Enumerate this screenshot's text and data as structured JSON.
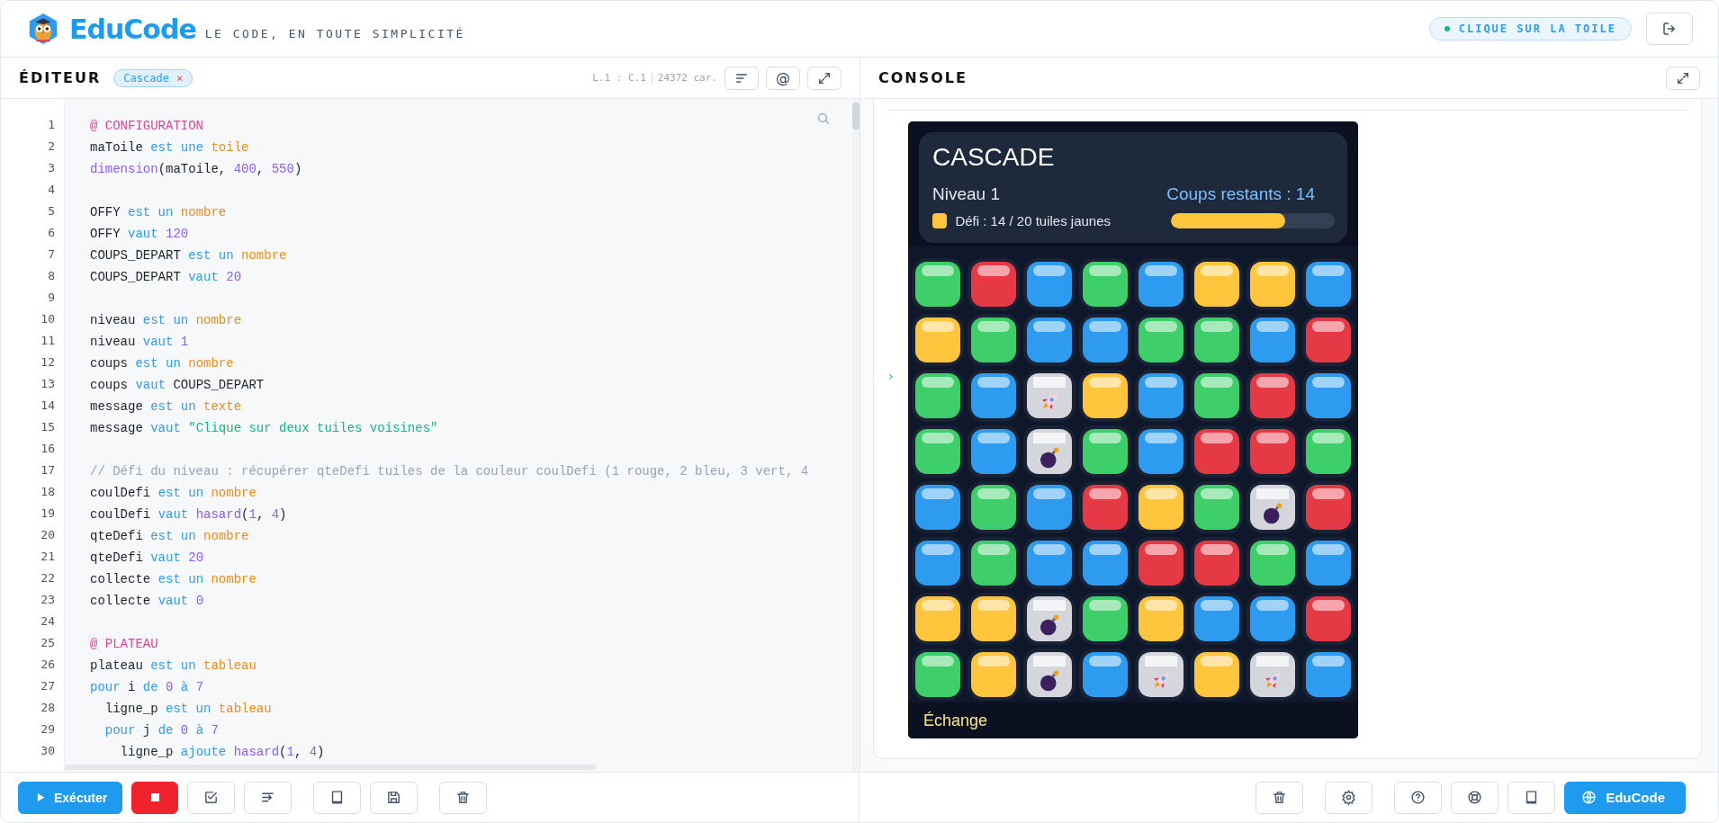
{
  "header": {
    "brand": "EduCode",
    "tagline": "LE CODE, EN TOUTE SIMPLICITÉ",
    "status": "CLIQUE SUR LA TOILE"
  },
  "editor": {
    "title": "ÉDITEUR",
    "tabs": [
      {
        "label": "Cascade",
        "close": "×",
        "selected": true
      }
    ],
    "cursor": "L.1 : C.1",
    "chars": "24372 car.",
    "at_button": "@",
    "lines": [
      {
        "number": "1",
        "tokens": [
          {
            "kind": "section",
            "text": "@ CONFIGURATION"
          }
        ]
      },
      {
        "number": "2",
        "tokens": [
          {
            "kind": "plain",
            "text": "maToile "
          },
          {
            "kind": "keyword",
            "text": "est une "
          },
          {
            "kind": "type",
            "text": "toile"
          }
        ]
      },
      {
        "number": "3",
        "tokens": [
          {
            "kind": "function",
            "text": "dimension"
          },
          {
            "kind": "plain",
            "text": "(maToile, "
          },
          {
            "kind": "number",
            "text": "400"
          },
          {
            "kind": "plain",
            "text": ", "
          },
          {
            "kind": "number",
            "text": "550"
          },
          {
            "kind": "plain",
            "text": ")"
          }
        ]
      },
      {
        "number": "4"
      },
      {
        "number": "5",
        "tokens": [
          {
            "kind": "plain",
            "text": "OFFY "
          },
          {
            "kind": "keyword",
            "text": "est un "
          },
          {
            "kind": "type",
            "text": "nombre"
          }
        ]
      },
      {
        "number": "6",
        "tokens": [
          {
            "kind": "plain",
            "text": "OFFY "
          },
          {
            "kind": "keyword",
            "text": "vaut "
          },
          {
            "kind": "number",
            "text": "120"
          }
        ]
      },
      {
        "number": "7",
        "tokens": [
          {
            "kind": "plain",
            "text": "COUPS_DEPART "
          },
          {
            "kind": "keyword",
            "text": "est un "
          },
          {
            "kind": "type",
            "text": "nombre"
          }
        ]
      },
      {
        "number": "8",
        "tokens": [
          {
            "kind": "plain",
            "text": "COUPS_DEPART "
          },
          {
            "kind": "keyword",
            "text": "vaut "
          },
          {
            "kind": "number",
            "text": "20"
          }
        ]
      },
      {
        "number": "9"
      },
      {
        "number": "10",
        "tokens": [
          {
            "kind": "plain",
            "text": "niveau "
          },
          {
            "kind": "keyword",
            "text": "est un "
          },
          {
            "kind": "type",
            "text": "nombre"
          }
        ]
      },
      {
        "number": "11",
        "tokens": [
          {
            "kind": "plain",
            "text": "niveau "
          },
          {
            "kind": "keyword",
            "text": "vaut "
          },
          {
            "kind": "number",
            "text": "1"
          }
        ]
      },
      {
        "number": "12",
        "tokens": [
          {
            "kind": "plain",
            "text": "coups "
          },
          {
            "kind": "keyword",
            "text": "est un "
          },
          {
            "kind": "type",
            "text": "nombre"
          }
        ]
      },
      {
        "number": "13",
        "tokens": [
          {
            "kind": "plain",
            "text": "coups "
          },
          {
            "kind": "keyword",
            "text": "vaut "
          },
          {
            "kind": "plain",
            "text": "COUPS_DEPART"
          }
        ]
      },
      {
        "number": "14",
        "tokens": [
          {
            "kind": "plain",
            "text": "message "
          },
          {
            "kind": "keyword",
            "text": "est un "
          },
          {
            "kind": "type",
            "text": "texte"
          }
        ]
      },
      {
        "number": "15",
        "tokens": [
          {
            "kind": "plain",
            "text": "message "
          },
          {
            "kind": "keyword",
            "text": "vaut "
          },
          {
            "kind": "string",
            "text": "\"Clique sur deux tuiles voisines\""
          }
        ]
      },
      {
        "number": "16"
      },
      {
        "number": "17",
        "tokens": [
          {
            "kind": "comment",
            "text": "// Défi du niveau : récupérer qteDefi tuiles de la couleur coulDefi (1 rouge, 2 bleu, 3 vert, 4"
          }
        ]
      },
      {
        "number": "18",
        "tokens": [
          {
            "kind": "plain",
            "text": "coulDefi "
          },
          {
            "kind": "keyword",
            "text": "est un "
          },
          {
            "kind": "type",
            "text": "nombre"
          }
        ]
      },
      {
        "number": "19",
        "tokens": [
          {
            "kind": "plain",
            "text": "coulDefi "
          },
          {
            "kind": "keyword",
            "text": "vaut "
          },
          {
            "kind": "function",
            "text": "hasard"
          },
          {
            "kind": "plain",
            "text": "("
          },
          {
            "kind": "number",
            "text": "1"
          },
          {
            "kind": "plain",
            "text": ", "
          },
          {
            "kind": "number",
            "text": "4"
          },
          {
            "kind": "plain",
            "text": ")"
          }
        ]
      },
      {
        "number": "20",
        "tokens": [
          {
            "kind": "plain",
            "text": "qteDefi "
          },
          {
            "kind": "keyword",
            "text": "est un "
          },
          {
            "kind": "type",
            "text": "nombre"
          }
        ]
      },
      {
        "number": "21",
        "tokens": [
          {
            "kind": "plain",
            "text": "qteDefi "
          },
          {
            "kind": "keyword",
            "text": "vaut "
          },
          {
            "kind": "number",
            "text": "20"
          }
        ]
      },
      {
        "number": "22",
        "tokens": [
          {
            "kind": "plain",
            "text": "collecte "
          },
          {
            "kind": "keyword",
            "text": "est un "
          },
          {
            "kind": "type",
            "text": "nombre"
          }
        ]
      },
      {
        "number": "23",
        "tokens": [
          {
            "kind": "plain",
            "text": "collecte "
          },
          {
            "kind": "keyword",
            "text": "vaut "
          },
          {
            "kind": "number",
            "text": "0"
          }
        ]
      },
      {
        "number": "24"
      },
      {
        "number": "25",
        "tokens": [
          {
            "kind": "section",
            "text": "@ PLATEAU"
          }
        ]
      },
      {
        "number": "26",
        "tokens": [
          {
            "kind": "plain",
            "text": "plateau "
          },
          {
            "kind": "keyword",
            "text": "est un "
          },
          {
            "kind": "type",
            "text": "tableau"
          }
        ]
      },
      {
        "number": "27",
        "tokens": [
          {
            "kind": "keyword",
            "text": "pour "
          },
          {
            "kind": "plain",
            "text": "i "
          },
          {
            "kind": "keyword",
            "text": "de "
          },
          {
            "kind": "number",
            "text": "0"
          },
          {
            "kind": "keyword",
            "text": " à "
          },
          {
            "kind": "number",
            "text": "7"
          }
        ]
      },
      {
        "number": "28",
        "tokens": [
          {
            "kind": "plain",
            "text": "  ligne_p "
          },
          {
            "kind": "keyword",
            "text": "est un "
          },
          {
            "kind": "type",
            "text": "tableau"
          }
        ]
      },
      {
        "number": "29",
        "tokens": [
          {
            "kind": "keyword",
            "text": "  pour "
          },
          {
            "kind": "plain",
            "text": "j "
          },
          {
            "kind": "keyword",
            "text": "de "
          },
          {
            "kind": "number",
            "text": "0"
          },
          {
            "kind": "keyword",
            "text": " à "
          },
          {
            "kind": "number",
            "text": "7"
          }
        ]
      },
      {
        "number": "30",
        "tokens": [
          {
            "kind": "plain",
            "text": "    ligne_p "
          },
          {
            "kind": "keyword",
            "text": "ajoute "
          },
          {
            "kind": "function",
            "text": "hasard"
          },
          {
            "kind": "plain",
            "text": "("
          },
          {
            "kind": "number",
            "text": "1"
          },
          {
            "kind": "plain",
            "text": ", "
          },
          {
            "kind": "number",
            "text": "4"
          },
          {
            "kind": "plain",
            "text": ")"
          }
        ]
      }
    ]
  },
  "console": {
    "title": "CONSOLE",
    "prompt": "›",
    "game": {
      "title": "CASCADE",
      "level": "Niveau 1",
      "moves": "Coups restants : 14",
      "challenge": {
        "label": "Défi : 14 / 20 tuiles jaunes",
        "color": "#ffc53d",
        "level": 0.7
      },
      "board": [
        [
          {
            "kind": "tile",
            "color": "#3ecf6a"
          },
          {
            "kind": "tile",
            "color": "#e63946"
          },
          {
            "kind": "tile",
            "color": "#2d9cf0"
          },
          {
            "kind": "tile",
            "color": "#3ecf6a"
          },
          {
            "kind": "tile",
            "color": "#2d9cf0"
          },
          {
            "kind": "tile",
            "color": "#ffc53d"
          },
          {
            "kind": "tile",
            "color": "#ffc53d"
          },
          {
            "kind": "tile",
            "color": "#2d9cf0"
          }
        ],
        [
          {
            "kind": "tile",
            "color": "#ffc53d"
          },
          {
            "kind": "tile",
            "color": "#3ecf6a"
          },
          {
            "kind": "tile",
            "color": "#2d9cf0"
          },
          {
            "kind": "tile",
            "color": "#2d9cf0"
          },
          {
            "kind": "tile",
            "color": "#3ecf6a"
          },
          {
            "kind": "tile",
            "color": "#3ecf6a"
          },
          {
            "kind": "tile",
            "color": "#2d9cf0"
          },
          {
            "kind": "tile",
            "color": "#e63946"
          }
        ],
        [
          {
            "kind": "tile",
            "color": "#3ecf6a"
          },
          {
            "kind": "tile",
            "color": "#2d9cf0"
          },
          {
            "kind": "rocket"
          },
          {
            "kind": "tile",
            "color": "#ffc53d"
          },
          {
            "kind": "tile",
            "color": "#2d9cf0"
          },
          {
            "kind": "tile",
            "color": "#3ecf6a"
          },
          {
            "kind": "tile",
            "color": "#e63946"
          },
          {
            "kind": "tile",
            "color": "#2d9cf0"
          }
        ],
        [
          {
            "kind": "tile",
            "color": "#3ecf6a"
          },
          {
            "kind": "tile",
            "color": "#2d9cf0"
          },
          {
            "kind": "bomb"
          },
          {
            "kind": "tile",
            "color": "#3ecf6a"
          },
          {
            "kind": "tile",
            "color": "#2d9cf0"
          },
          {
            "kind": "tile",
            "color": "#e63946"
          },
          {
            "kind": "tile",
            "color": "#e63946"
          },
          {
            "kind": "tile",
            "color": "#3ecf6a"
          }
        ],
        [
          {
            "kind": "tile",
            "color": "#2d9cf0"
          },
          {
            "kind": "tile",
            "color": "#3ecf6a"
          },
          {
            "kind": "tile",
            "color": "#2d9cf0"
          },
          {
            "kind": "tile",
            "color": "#e63946"
          },
          {
            "kind": "tile",
            "color": "#ffc53d"
          },
          {
            "kind": "tile",
            "color": "#3ecf6a"
          },
          {
            "kind": "bomb"
          },
          {
            "kind": "tile",
            "color": "#e63946"
          }
        ],
        [
          {
            "kind": "tile",
            "color": "#2d9cf0"
          },
          {
            "kind": "tile",
            "color": "#3ecf6a"
          },
          {
            "kind": "tile",
            "color": "#2d9cf0"
          },
          {
            "kind": "tile",
            "color": "#2d9cf0"
          },
          {
            "kind": "tile",
            "color": "#e63946"
          },
          {
            "kind": "tile",
            "color": "#e63946"
          },
          {
            "kind": "tile",
            "color": "#3ecf6a"
          },
          {
            "kind": "tile",
            "color": "#2d9cf0"
          }
        ],
        [
          {
            "kind": "tile",
            "color": "#ffc53d"
          },
          {
            "kind": "tile",
            "color": "#ffc53d"
          },
          {
            "kind": "bomb"
          },
          {
            "kind": "tile",
            "color": "#3ecf6a"
          },
          {
            "kind": "tile",
            "color": "#ffc53d"
          },
          {
            "kind": "tile",
            "color": "#2d9cf0"
          },
          {
            "kind": "tile",
            "color": "#2d9cf0"
          },
          {
            "kind": "tile",
            "color": "#e63946"
          }
        ],
        [
          {
            "kind": "tile",
            "color": "#3ecf6a"
          },
          {
            "kind": "tile",
            "color": "#ffc53d"
          },
          {
            "kind": "bomb"
          },
          {
            "kind": "tile",
            "color": "#2d9cf0"
          },
          {
            "kind": "rocket"
          },
          {
            "kind": "tile",
            "color": "#ffc53d"
          },
          {
            "kind": "rocket"
          },
          {
            "kind": "tile",
            "color": "#2d9cf0"
          }
        ]
      ],
      "footer": "Échange"
    }
  },
  "toolbar": {
    "run": "Exécuter",
    "brand_button": "EduCode"
  }
}
